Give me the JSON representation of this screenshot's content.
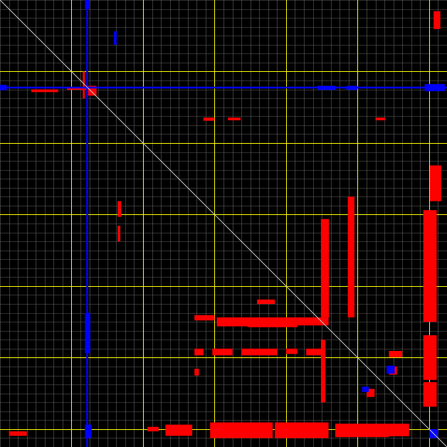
{
  "colors": {
    "background": "#000000",
    "minor_grid": "#808080",
    "major_grid": "#ffff00",
    "diagonal": "#c8c8c8",
    "positive": "#ff0000",
    "negative": "#0000ff"
  },
  "chart_data": {
    "type": "heatmap",
    "matrix_extent": [
      0,
      100
    ],
    "grid": true,
    "minor_grid_step": 2,
    "major_grid_step": 16,
    "diagonal": true,
    "series": [
      {
        "color_key": "positive",
        "marks": [
          {
            "x": 19.4,
            "y": 19.2,
            "w": 2.2,
            "h": 2.2
          },
          {
            "x": 18.5,
            "y": 16.0,
            "w": 0.5,
            "h": 6.0
          },
          {
            "x": 15.0,
            "y": 19.6,
            "w": 6.5,
            "h": 0.5
          },
          {
            "x": 7.0,
            "y": 20.0,
            "w": 6.0,
            "h": 0.6
          },
          {
            "x": 45.5,
            "y": 26.3,
            "w": 2.5,
            "h": 0.7
          },
          {
            "x": 51.0,
            "y": 26.3,
            "w": 2.8,
            "h": 0.6
          },
          {
            "x": 84.0,
            "y": 26.3,
            "w": 2.2,
            "h": 0.6
          },
          {
            "x": 97.0,
            "y": 2.5,
            "w": 1.5,
            "h": 4.0
          },
          {
            "x": 96.2,
            "y": 37.0,
            "w": 2.5,
            "h": 8.0
          },
          {
            "x": 94.7,
            "y": 47.0,
            "w": 3.0,
            "h": 25.0
          },
          {
            "x": 94.7,
            "y": 75.0,
            "w": 3.0,
            "h": 10.0
          },
          {
            "x": 94.7,
            "y": 85.5,
            "w": 3.0,
            "h": 5.5
          },
          {
            "x": 71.8,
            "y": 49.0,
            "w": 1.8,
            "h": 22.0
          },
          {
            "x": 71.8,
            "y": 76.0,
            "w": 1.0,
            "h": 14.0
          },
          {
            "x": 77.8,
            "y": 44.0,
            "w": 1.5,
            "h": 27.0
          },
          {
            "x": 26.3,
            "y": 45.0,
            "w": 0.8,
            "h": 3.5
          },
          {
            "x": 26.3,
            "y": 50.5,
            "w": 0.6,
            "h": 3.5
          },
          {
            "x": 48.5,
            "y": 71.0,
            "w": 7.0,
            "h": 2.0
          },
          {
            "x": 55.5,
            "y": 71.0,
            "w": 11.0,
            "h": 2.2
          },
          {
            "x": 66.5,
            "y": 71.0,
            "w": 7.0,
            "h": 1.8
          },
          {
            "x": 43.5,
            "y": 70.5,
            "w": 4.5,
            "h": 1.2
          },
          {
            "x": 57.5,
            "y": 67.0,
            "w": 4.0,
            "h": 1.0
          },
          {
            "x": 43.5,
            "y": 78.0,
            "w": 2.0,
            "h": 1.5
          },
          {
            "x": 47.5,
            "y": 78.0,
            "w": 4.5,
            "h": 1.5
          },
          {
            "x": 54.0,
            "y": 78.0,
            "w": 8.0,
            "h": 1.5
          },
          {
            "x": 64.0,
            "y": 78.0,
            "w": 2.5,
            "h": 1.2
          },
          {
            "x": 68.5,
            "y": 78.0,
            "w": 3.5,
            "h": 1.5
          },
          {
            "x": 87.0,
            "y": 78.5,
            "w": 3.0,
            "h": 1.4
          },
          {
            "x": 43.5,
            "y": 82.5,
            "w": 1.0,
            "h": 1.5
          },
          {
            "x": 82.0,
            "y": 87.0,
            "w": 1.8,
            "h": 1.8
          },
          {
            "x": 87.0,
            "y": 82.0,
            "w": 1.8,
            "h": 1.8
          },
          {
            "x": 37.0,
            "y": 95.0,
            "w": 6.0,
            "h": 2.5
          },
          {
            "x": 47.0,
            "y": 94.5,
            "w": 14.0,
            "h": 3.5
          },
          {
            "x": 61.5,
            "y": 94.5,
            "w": 12.0,
            "h": 3.5
          },
          {
            "x": 75.0,
            "y": 94.8,
            "w": 12.0,
            "h": 3.0
          },
          {
            "x": 87.0,
            "y": 94.8,
            "w": 4.5,
            "h": 2.8
          },
          {
            "x": 2.0,
            "y": 96.5,
            "w": 4.0,
            "h": 1.0
          },
          {
            "x": 33.0,
            "y": 95.5,
            "w": 2.5,
            "h": 1.0
          }
        ]
      },
      {
        "color_key": "negative",
        "marks": [
          {
            "x": 0.0,
            "y": 19.4,
            "w": 100.0,
            "h": 0.4
          },
          {
            "x": 71.0,
            "y": 19.2,
            "w": 4.0,
            "h": 0.9
          },
          {
            "x": 77.5,
            "y": 19.2,
            "w": 2.5,
            "h": 0.9
          },
          {
            "x": 95.0,
            "y": 18.8,
            "w": 4.5,
            "h": 1.6
          },
          {
            "x": 0.0,
            "y": 19.0,
            "w": 1.5,
            "h": 1.2
          },
          {
            "x": 19.3,
            "y": 0.0,
            "w": 0.4,
            "h": 100.0
          },
          {
            "x": 19.0,
            "y": 70.0,
            "w": 1.2,
            "h": 9.0
          },
          {
            "x": 19.0,
            "y": 95.0,
            "w": 1.5,
            "h": 3.0
          },
          {
            "x": 19.0,
            "y": 0.0,
            "w": 1.0,
            "h": 2.0
          },
          {
            "x": 25.5,
            "y": 7.0,
            "w": 0.6,
            "h": 3.0
          },
          {
            "x": 86.5,
            "y": 81.8,
            "w": 1.8,
            "h": 1.8
          },
          {
            "x": 96.0,
            "y": 96.0,
            "w": 2.0,
            "h": 2.0
          },
          {
            "x": 81.0,
            "y": 86.5,
            "w": 1.5,
            "h": 1.2
          }
        ]
      }
    ]
  }
}
